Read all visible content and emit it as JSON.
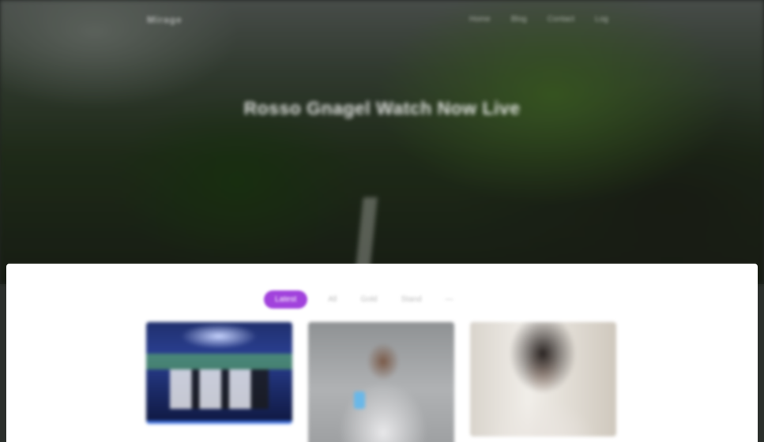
{
  "nav": {
    "logo": "Mirage",
    "menu": [
      "Home",
      "Blog",
      "Contact",
      "Log"
    ]
  },
  "hero": {
    "title": "Rosso Gnagel Watch Now Live"
  },
  "filters": {
    "tabs": [
      "Latest",
      "All",
      "Gold",
      "Stand",
      "—"
    ],
    "active_index": 0,
    "active_color": "#a142dc"
  },
  "cards": [
    {
      "id": "card-1"
    },
    {
      "id": "card-2"
    },
    {
      "id": "card-3"
    }
  ]
}
